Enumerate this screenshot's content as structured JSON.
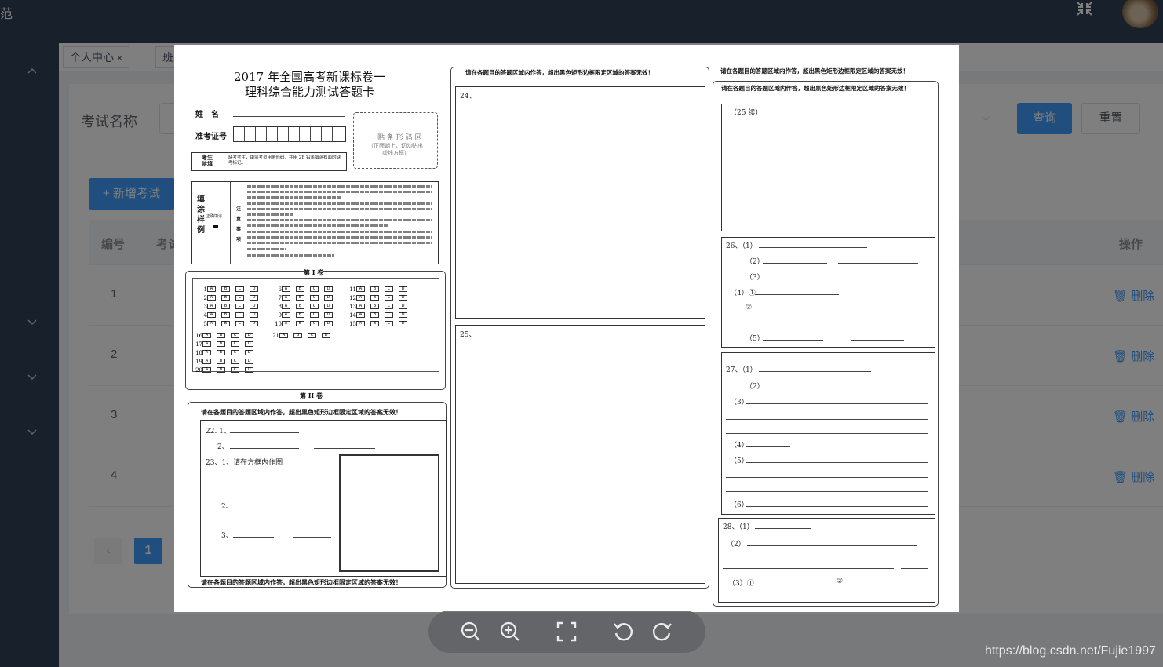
{
  "topbar": {
    "left_glyph": "范",
    "fullscreen_icon": "fullscreen-exit-icon",
    "avatar": "user-avatar"
  },
  "tags": [
    {
      "label": "个人中心",
      "close": "×"
    },
    {
      "label": "班"
    }
  ],
  "search": {
    "label": "考试名称",
    "query_button": "查询",
    "reset_button": "重置"
  },
  "table": {
    "add_button": "新增考试",
    "add_icon": "+",
    "headers": {
      "id": "编号",
      "name": "考试",
      "actions": "操作"
    },
    "rows": [
      {
        "id": "1",
        "action": "删除"
      },
      {
        "id": "2",
        "action": "删除"
      },
      {
        "id": "3",
        "action": "删除"
      },
      {
        "id": "4",
        "action": "删除"
      }
    ]
  },
  "pagination": {
    "current": "1",
    "prev": "‹"
  },
  "viewer": {
    "title_line1": "2017 年全国高考新课标卷一",
    "title_line2": "理科综合能力测试答题卡",
    "name_label": "姓　名",
    "exam_no_label": "准考证号",
    "barcode_area": "贴 条 形 码 区",
    "barcode_note": "（正面朝上，切勿贴出",
    "barcode_note2": "虚线方框）",
    "candidate_label": "考生\n禁填",
    "candidate_note": "缺考考生，由监考员用条形码，并用 2B 铅笔填涂右面的缺考标记。",
    "fill_example_label": "填\n涂\n样\n例",
    "correct_fill": "正确填涂",
    "notice_label": "注\n意\n事\n项",
    "part1": "第 I 卷",
    "part2": "第 II 卷",
    "warning": "请在各题目的答题区域内作答，超出黑色矩形边框限定区域的答案无效！",
    "q22_1": "22. 1、",
    "q22_2": "2、",
    "q23": "23、1、请在方框内作图",
    "q23_2": "2、",
    "q23_3": "3、",
    "q24": "24、",
    "q25": "25、",
    "q25_cont": "（25 续）",
    "q26": "26、（1）",
    "q26_2": "（2）",
    "q26_3": "（3）",
    "q26_4": "（4）①",
    "q26_4b": "②",
    "q26_5": "（5）",
    "q27": "27、（1）",
    "q27_2": "（2）",
    "q27_3": "（3）",
    "q27_4": "（4）",
    "q27_5": "（5）",
    "q27_6": "（6）",
    "q28": "28、（1）",
    "q28_2": "（2）",
    "q28_3": "（3）①",
    "q28_3b": "②",
    "options": [
      "A",
      "B",
      "C",
      "D"
    ],
    "mc_col1": [
      "1",
      "2",
      "3",
      "4",
      "5"
    ],
    "mc_col2": [
      "6",
      "7",
      "8",
      "9",
      "10"
    ],
    "mc_col3": [
      "11",
      "12",
      "13",
      "14",
      "15"
    ],
    "mc_col4": [
      "16",
      "17",
      "18",
      "19",
      "20"
    ],
    "mc_col5": [
      "21"
    ]
  },
  "viewer_toolbar": {
    "tools": [
      "zoom-out-icon",
      "zoom-in-icon",
      "fit-screen-icon",
      "rotate-left-icon",
      "rotate-right-icon"
    ]
  },
  "watermark": "https://blog.csdn.net/Fujie1997"
}
